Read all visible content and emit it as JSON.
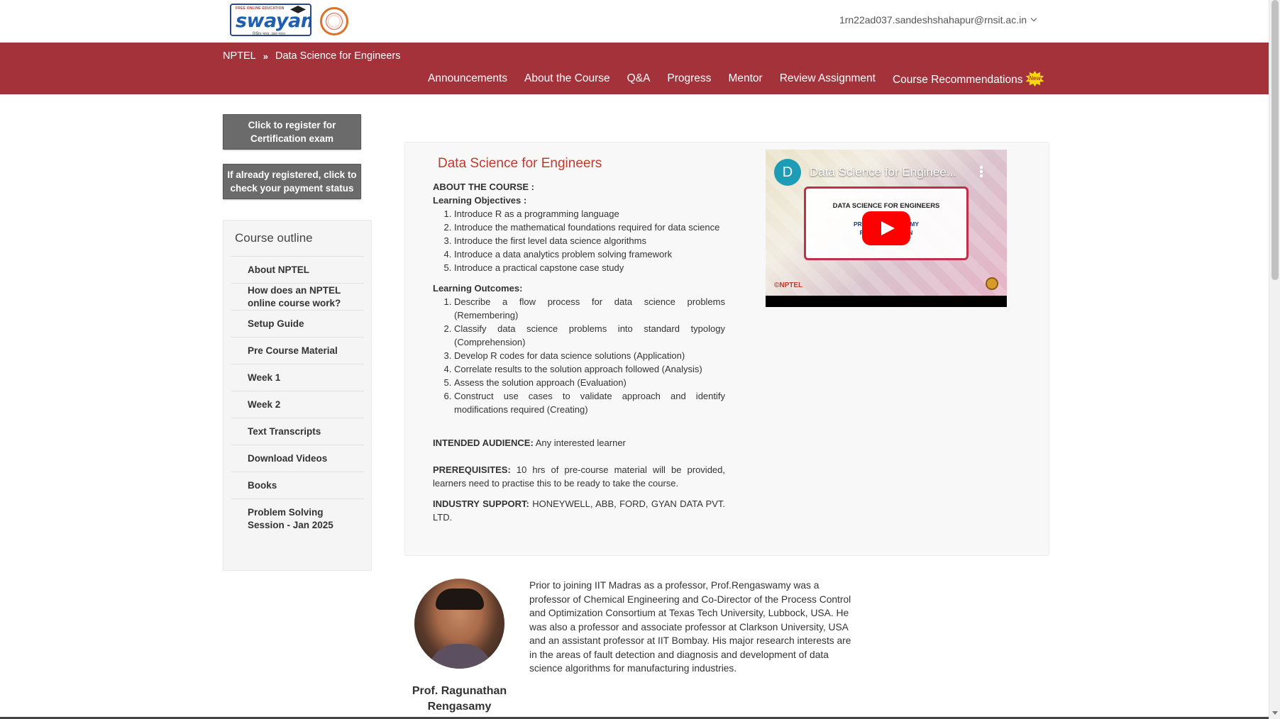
{
  "header": {
    "logo": {
      "brand": "swayam",
      "tagline": "FREE ONLINE EDUCATION",
      "subtitle": "शिक्षित भारत, उन्नत भारत"
    },
    "user_email": "1rn22ad037.sandeshshahapur@rnsit.ac.in",
    "icons": {
      "user_menu": "chevron-down-icon",
      "emblem": "emblem-logo-icon"
    }
  },
  "breadcrumb": {
    "root": "NPTEL",
    "separator": "»",
    "current": "Data Science for Engineers"
  },
  "nav": [
    {
      "label": "Announcements"
    },
    {
      "label": "About the Course"
    },
    {
      "label": "Q&A"
    },
    {
      "label": "Progress"
    },
    {
      "label": "Mentor"
    },
    {
      "label": "Review Assignment"
    },
    {
      "label": "Course Recommendations",
      "badge": "New"
    }
  ],
  "sidebar": {
    "register_button": "Click to register for Certification exam",
    "status_button": "If already registered, click to check your payment status",
    "outline_title": "Course outline",
    "items": [
      "About NPTEL",
      "How does an NPTEL online course work?",
      "Setup Guide",
      "Pre Course Material",
      "Week 1",
      "Week 2",
      "Text Transcripts",
      "Download Videos",
      "Books",
      "Problem Solving Session - Jan 2025"
    ]
  },
  "course": {
    "title": "Data Science for Engineers",
    "about_heading": "ABOUT THE COURSE :",
    "objectives_heading": "Learning Objectives :",
    "objectives": [
      "Introduce R as a programming language",
      "Introduce the mathematical foundations required for data science",
      "Introduce the first level data science algorithms",
      "Introduce a data analytics problem solving framework",
      "Introduce a practical capstone case study"
    ],
    "outcomes_heading": "Learning Outcomes:",
    "outcomes": [
      "Describe a flow process for data science problems (Remembering)",
      "Classify data science problems into standard typology (Comprehension)",
      "Develop R codes for data science solutions (Application)",
      "Correlate results to the solution approach followed (Analysis)",
      "Assess the solution approach (Evaluation)",
      "Construct use cases to validate approach and identify modifications required (Creating)"
    ],
    "audience_label": "INTENDED AUDIENCE:",
    "audience_value": " Any interested learner",
    "prereq_label": "PREREQUISITES:",
    "prereq_value": " 10 hrs of pre-course material will be provided, learners need to practise this to be ready to take the course.",
    "industry_label": "INDUSTRY SUPPORT:",
    "industry_value": " HONEYWELL, ABB, FORD, GYAN DATA PVT. LTD."
  },
  "video": {
    "channel_initial": "D",
    "title": "Data Science for Enginee...",
    "card_title": "DATA SCIENCE FOR ENGINEERS",
    "card_line1": "PROF. RAG          NGASAMY",
    "card_line2": "PROF. S          ASIMHAN",
    "watermark": "©NPTEL",
    "icons": {
      "play": "play-button-icon",
      "menu": "more-vert-icon"
    }
  },
  "professor": {
    "name_line1": "Prof. Ragunathan",
    "name_line2": "Rengasamy",
    "bio": "Prior to joining IIT Madras as a professor, Prof.Rengaswamy was a professor of Chemical Engineering and Co-Director of the Process Control and Optimization Consortium at Texas Tech University, Lubbock, USA. He was also a professor and associate professor at Clarkson University, USA and an assistant professor at IIT Bombay. His major research interests are in the areas of fault detection and diagnosis and development of data science algorithms for manufacturing industries."
  },
  "colors": {
    "nav_band": "#a4323a",
    "title_red": "#c0392b",
    "button_gray": "#6b6b6b",
    "youtube_red": "#ff0000"
  }
}
